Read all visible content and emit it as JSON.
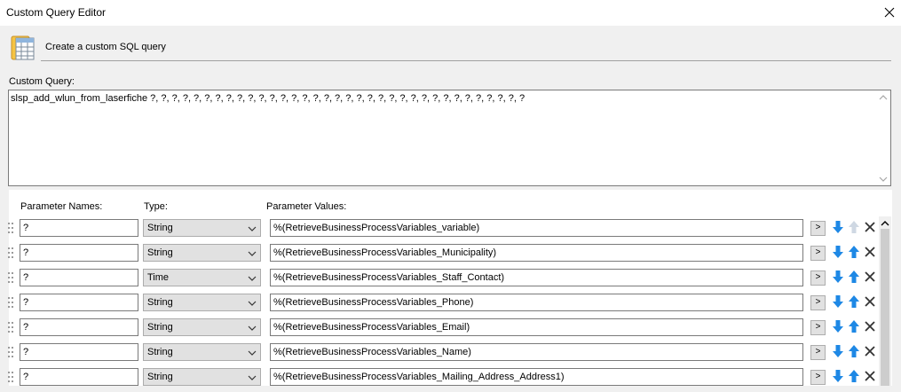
{
  "window": {
    "title": "Custom Query Editor",
    "close_icon": "close-icon"
  },
  "header": {
    "text": "Create a custom SQL query",
    "icon": "sql-table-icon"
  },
  "query": {
    "label": "Custom Query:",
    "value": "slsp_add_wlun_from_laserfiche ?, ?, ?, ?, ?, ?, ?, ?, ?, ?, ?, ?, ?, ?, ?, ?, ?, ?, ?, ?, ?, ?, ?, ?, ?, ?, ?, ?, ?, ?, ?, ?, ?, ?, ?"
  },
  "grid": {
    "headers": {
      "names": "Parameter Names:",
      "type": "Type:",
      "values": "Parameter Values:"
    },
    "rows": [
      {
        "name": "?",
        "type": "String",
        "value": "%(RetrieveBusinessProcessVariables_variable)",
        "up_enabled": false
      },
      {
        "name": "?",
        "type": "String",
        "value": "%(RetrieveBusinessProcessVariables_Municipality)",
        "up_enabled": true
      },
      {
        "name": "?",
        "type": "Time",
        "value": "%(RetrieveBusinessProcessVariables_Staff_Contact)",
        "up_enabled": true
      },
      {
        "name": "?",
        "type": "String",
        "value": "%(RetrieveBusinessProcessVariables_Phone)",
        "up_enabled": true
      },
      {
        "name": "?",
        "type": "String",
        "value": "%(RetrieveBusinessProcessVariables_Email)",
        "up_enabled": true
      },
      {
        "name": "?",
        "type": "String",
        "value": "%(RetrieveBusinessProcessVariables_Name)",
        "up_enabled": true
      },
      {
        "name": "?",
        "type": "String",
        "value": "%(RetrieveBusinessProcessVariables_Mailing_Address_Address1)",
        "up_enabled": true
      }
    ],
    "browse_label": ">"
  },
  "colors": {
    "arrow": "#1e88e5",
    "arrow_disabled": "#cfd8e3",
    "delete": "#333333"
  }
}
